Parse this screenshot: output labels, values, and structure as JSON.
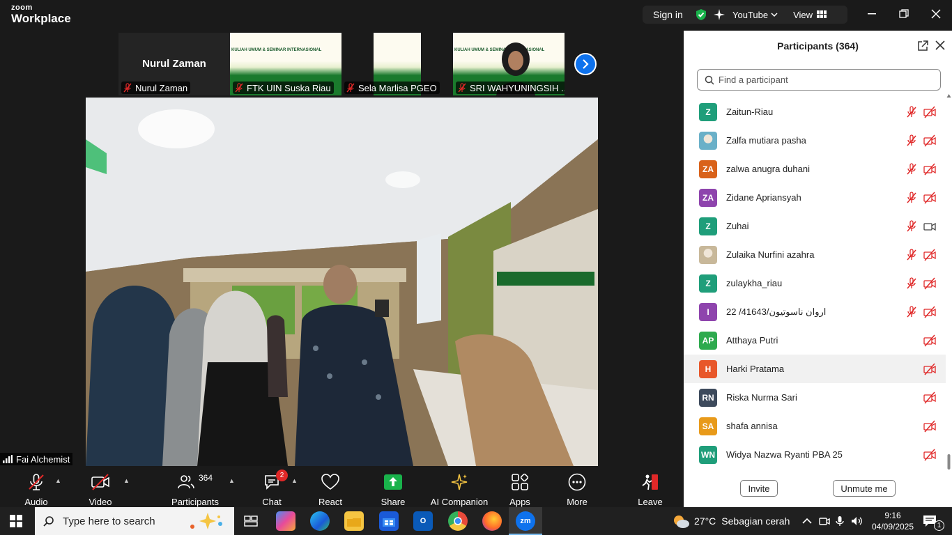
{
  "titlebar": {
    "logo_top": "zoom",
    "logo_bottom": "Workplace",
    "sign_in": "Sign in",
    "youtube_label": "YouTube",
    "view_label": "View",
    "icons": [
      "shield-check-icon",
      "ai-sparkle-icon",
      "chevron-down-icon",
      "grid-icon",
      "minimize-icon",
      "restore-icon",
      "close-icon"
    ]
  },
  "thumbnails": [
    {
      "big_name": "Nurul Zaman",
      "label": "Nurul Zaman",
      "muted": true
    },
    {
      "label": "FTK UIN Suska Riau",
      "muted": true,
      "poster_title": "KULIAH UMUM & SEMINAR INTERNASIONAL"
    },
    {
      "label": "Sela Marlisa PGEO",
      "muted": true
    },
    {
      "label": "SRI WAHYUNINGSIH ...",
      "muted": true,
      "poster_title": "KULIAH UMUM & SEMINAR INTERNASIONAL"
    }
  ],
  "self_view": {
    "name": "Fai Alchemist"
  },
  "toolbar": {
    "audio": "Audio",
    "video": "Video",
    "participants": "Participants",
    "participants_count": "364",
    "chat": "Chat",
    "chat_badge": "2",
    "react": "React",
    "share": "Share",
    "ai_companion": "AI Companion",
    "apps": "Apps",
    "more": "More",
    "leave": "Leave"
  },
  "panel": {
    "title": "Participants (364)",
    "search_placeholder": "Find a participant",
    "participants": [
      {
        "initials": "Z",
        "name": "Zaitun-Riau",
        "color": "#1f9e7a",
        "mic_muted": true,
        "video": "off"
      },
      {
        "initials": "",
        "name": "Zalfa mutiara pasha",
        "color": "#6ab0c8",
        "mic_muted": true,
        "video": "off",
        "photo": true
      },
      {
        "initials": "ZA",
        "name": "zalwa anugra duhani",
        "color": "#d9621a",
        "mic_muted": true,
        "video": "off"
      },
      {
        "initials": "ZA",
        "name": "Zidane Apriansyah",
        "color": "#8e44ad",
        "mic_muted": true,
        "video": "off"
      },
      {
        "initials": "Z",
        "name": "Zuhai",
        "color": "#1f9e7a",
        "mic_muted": true,
        "video": "on"
      },
      {
        "initials": "",
        "name": "Zulaika Nurfini azahra",
        "color": "#c8b89a",
        "mic_muted": true,
        "video": "off",
        "photo": true
      },
      {
        "initials": "Z",
        "name": "zulaykha_riau",
        "color": "#1f9e7a",
        "mic_muted": true,
        "video": "off"
      },
      {
        "initials": "I",
        "name": "22 /41643/اروان ناسوتيون",
        "color": "#8e44ad",
        "mic_muted": true,
        "video": "off"
      },
      {
        "initials": "AP",
        "name": "Atthaya Putri",
        "color": "#2eaa4e",
        "mic_muted": false,
        "video": "off"
      },
      {
        "initials": "H",
        "name": "Harki Pratama",
        "color": "#e8572a",
        "mic_muted": false,
        "video": "off",
        "highlighted": true
      },
      {
        "initials": "RN",
        "name": "Riska Nurma Sari",
        "color": "#3d4a5c",
        "mic_muted": false,
        "video": "off"
      },
      {
        "initials": "SA",
        "name": "shafa annisa",
        "color": "#e89a1a",
        "mic_muted": false,
        "video": "off"
      },
      {
        "initials": "WN",
        "name": "Widya Nazwa Ryanti PBA 25",
        "color": "#1f9e7a",
        "mic_muted": false,
        "video": "off"
      }
    ],
    "invite": "Invite",
    "unmute_me": "Unmute me"
  },
  "taskbar": {
    "search_placeholder": "Type here to search",
    "weather_temp": "27°C",
    "weather_desc": "Sebagian cerah",
    "time": "9:16",
    "date": "04/09/2025",
    "notification_count": "1",
    "apps": [
      "task-view-icon",
      "copilot-icon",
      "edge-icon",
      "file-explorer-icon",
      "store-icon",
      "outlook-icon",
      "chrome-icon",
      "firefox-icon",
      "zoom-icon"
    ]
  }
}
